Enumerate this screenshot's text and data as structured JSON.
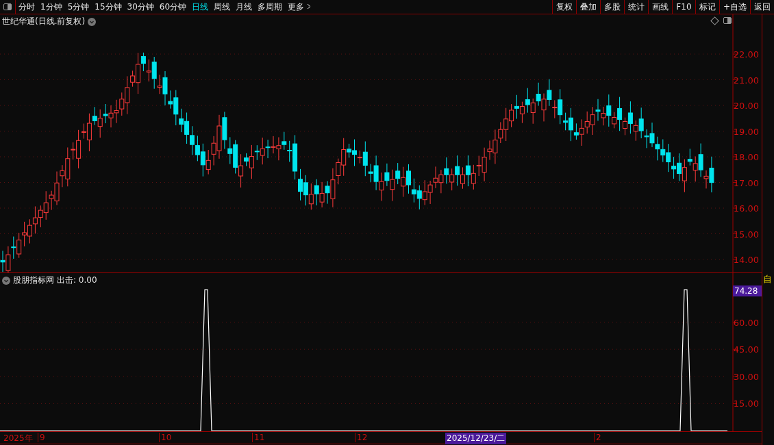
{
  "toolbar": {
    "periods": [
      {
        "label": "分时",
        "selected": false
      },
      {
        "label": "1分钟",
        "selected": false
      },
      {
        "label": "5分钟",
        "selected": false
      },
      {
        "label": "15分钟",
        "selected": false
      },
      {
        "label": "30分钟",
        "selected": false
      },
      {
        "label": "60分钟",
        "selected": false
      },
      {
        "label": "日线",
        "selected": true
      },
      {
        "label": "周线",
        "selected": false
      },
      {
        "label": "月线",
        "selected": false
      },
      {
        "label": "多周期",
        "selected": false
      }
    ],
    "more": "更多",
    "buttons": [
      "复权",
      "叠加",
      "多股",
      "统计",
      "画线",
      "F10",
      "标记",
      "+自选",
      "返回"
    ]
  },
  "main_chart": {
    "title": "世纪华通(日线.前复权)",
    "price_ticks": [
      "22.00",
      "21.00",
      "20.00",
      "19.00",
      "18.00",
      "17.00",
      "16.00",
      "15.00",
      "14.00"
    ]
  },
  "indicator": {
    "name": "股朋指标网",
    "reading": "出击: 0.00",
    "current_value": "74.28",
    "ticks": [
      "60.00",
      "45.00",
      "30.00",
      "15.00"
    ]
  },
  "x_axis": {
    "year": "2025年",
    "months": [
      {
        "label": "9"
      },
      {
        "label": "10"
      },
      {
        "label": "11"
      },
      {
        "label": "12"
      },
      {
        "label": "2"
      }
    ],
    "cursor_date": "2025/12/23/二"
  },
  "side_panel": {
    "label": "自"
  }
}
